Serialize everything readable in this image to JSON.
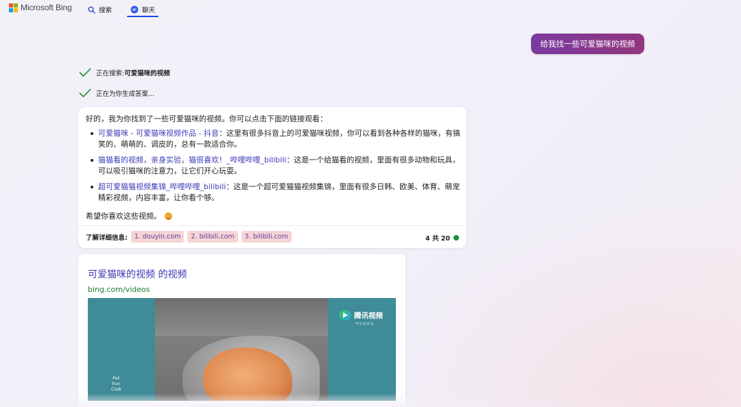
{
  "header": {
    "logo_text": "Microsoft Bing",
    "tabs": [
      {
        "label": "搜索",
        "icon": "search-icon",
        "active": false
      },
      {
        "label": "聊天",
        "icon": "chat-icon",
        "active": true
      }
    ]
  },
  "user_message": "给我找一些可爱猫咪的视频",
  "status": {
    "searching_prefix": "正在搜索: ",
    "searching_query": "可爱猫咪的视频",
    "generating": "正在为你生成答案..."
  },
  "answer": {
    "intro": "好的，我为你找到了一些可爱猫咪的视频。你可以点击下面的链接观看：",
    "items": [
      {
        "link": "可爱猫咪 - 可爱猫咪视频作品 - 抖音",
        "text": "：这里有很多抖音上的可爱猫咪视频，你可以看到各种各样的猫咪，有搞笑的、萌萌的、调皮的，总有一款适合你。"
      },
      {
        "link": "猫猫看的视频，亲身实验，猫很喜欢！_哔哩哔哩_bilibili",
        "text": "：这是一个给猫看的视频，里面有很多动物和玩具，可以吸引猫咪的注意力，让它们开心玩耍。"
      },
      {
        "link": "超可爱猫猫视频集锦_哔哩哔哩_bilibili",
        "text": "：这是一个超可爱猫猫视频集锦，里面有很多日韩、欧美、体育、萌宠精彩视频，内容丰富，让你看个够。"
      }
    ],
    "outro": "希望你喜欢这些视频。",
    "refs_label": "了解详细信息:",
    "refs": [
      "1. douyin.com",
      "2. bilibili.com",
      "3. bilibili.com"
    ],
    "count": "4 共 20"
  },
  "video": {
    "title": "可爱猫咪的视频 的视频",
    "url": "bing.com/videos",
    "thumb_left_text": "Pet\nFun\nClub",
    "thumb_brand": "腾讯视频",
    "thumb_brand_sub": "不负好时光"
  },
  "colors": {
    "accent": "#174ae4",
    "user_bubble": "#8a3892",
    "link": "#3d3bb8",
    "ref_chip": "#f6d4d6",
    "status_dot": "#1a8f3a"
  }
}
